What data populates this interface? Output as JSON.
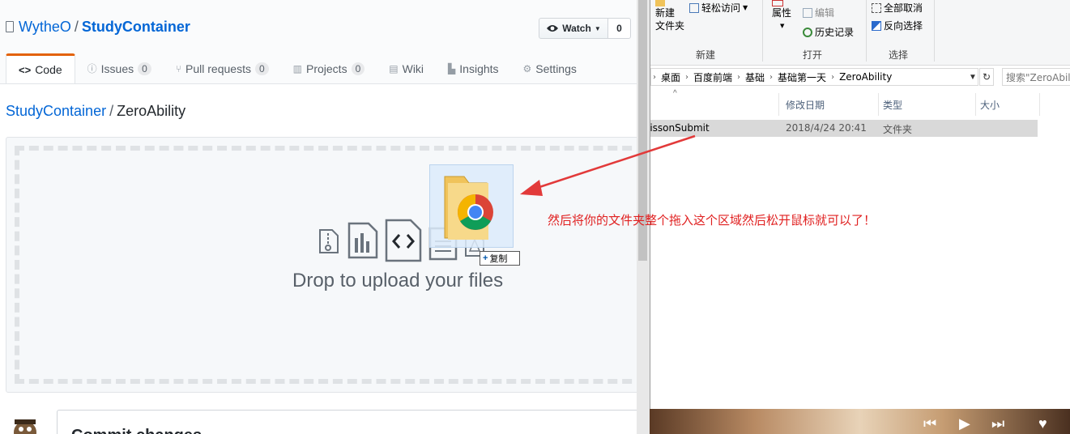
{
  "github": {
    "owner": "WytheO",
    "separator": "/",
    "repo": "StudyContainer",
    "watch_label": "Watch",
    "watch_count": "0",
    "tabs": [
      {
        "label": "Code",
        "icon": "code-icon",
        "counter": ""
      },
      {
        "label": "Issues",
        "icon": "issue-icon",
        "counter": "0"
      },
      {
        "label": "Pull requests",
        "icon": "pull-request-icon",
        "counter": "0"
      },
      {
        "label": "Projects",
        "icon": "project-icon",
        "counter": "0"
      },
      {
        "label": "Wiki",
        "icon": "book-icon",
        "counter": ""
      },
      {
        "label": "Insights",
        "icon": "graph-icon",
        "counter": ""
      },
      {
        "label": "Settings",
        "icon": "gear-icon",
        "counter": ""
      }
    ],
    "path": {
      "repo": "StudyContainer",
      "folder": "ZeroAbility"
    },
    "drop_text": "Drop to upload your files",
    "drag_badge": "复制",
    "commit_heading": "Commit changes",
    "accent": "#e36209",
    "link_color": "#0366d6"
  },
  "explorer": {
    "ribbon": {
      "new_folder": "新建\n文件夹",
      "easy_access": "轻松访问",
      "properties": "属性",
      "edit": "编辑",
      "history": "历史记录",
      "select_none": "全部取消",
      "invert_selection": "反向选择",
      "group_new": "新建",
      "group_open": "打开",
      "group_select": "选择"
    },
    "breadcrumb": [
      "桌面",
      "百度前端",
      "基础",
      "基础第一天",
      "ZeroAbility"
    ],
    "search_placeholder": "搜索\"ZeroAbili",
    "columns": {
      "date": "修改日期",
      "type": "类型",
      "size": "大小"
    },
    "rows": [
      {
        "name": "lissonSubmit",
        "date": "2018/4/24 20:41",
        "type": "文件夹",
        "size": ""
      }
    ]
  },
  "annotation": {
    "text": "然后将你的文件夹整个拖入这个区域然后松开鼠标就可以了！",
    "color": "#e02020"
  }
}
